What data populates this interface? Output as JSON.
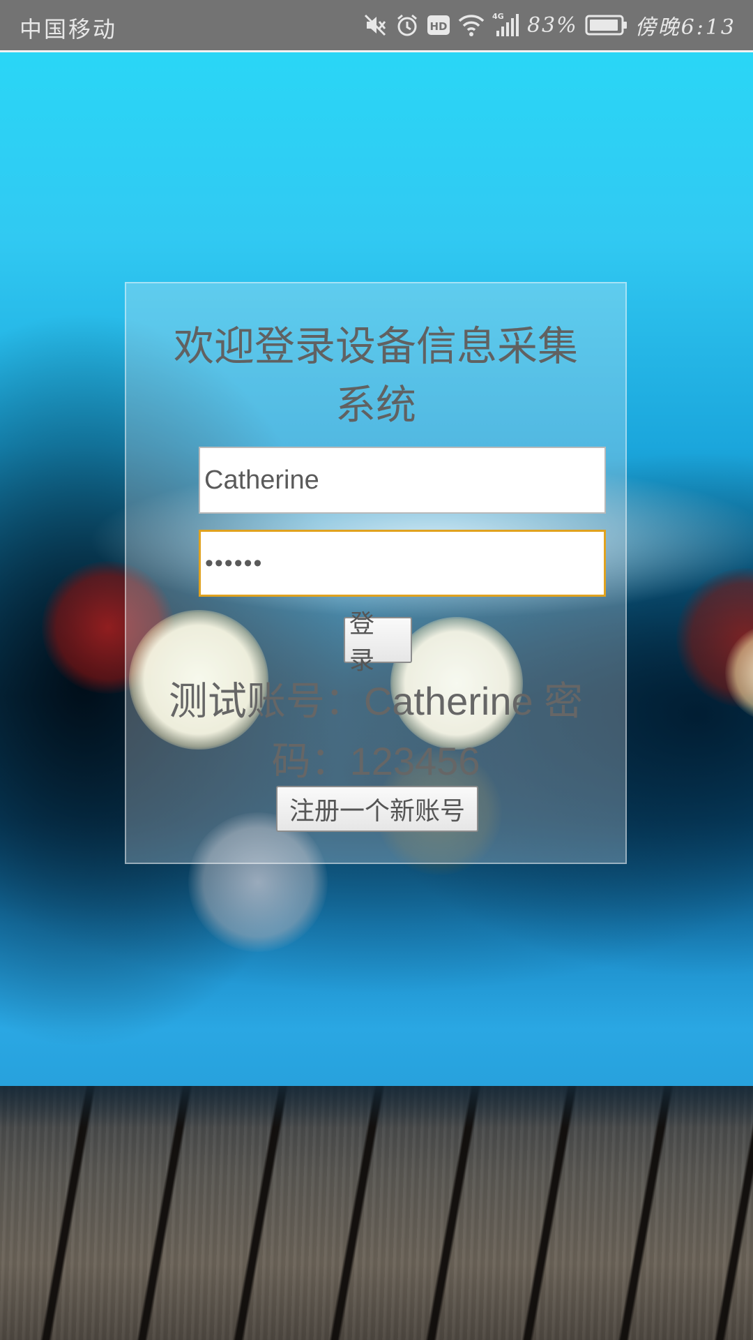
{
  "status_bar": {
    "carrier": "中国移动",
    "network": "4G",
    "battery_percent": "83%",
    "time": "傍晚6:13",
    "icons": [
      "mute-icon",
      "alarm-icon",
      "hd-icon",
      "wifi-icon",
      "cellular-signal-icon",
      "battery-icon"
    ]
  },
  "login": {
    "title_line1": "欢迎登录设备信息采集",
    "title_line2": "系统",
    "username_value": "Catherine",
    "password_value": "••••••",
    "login_button": "登 录",
    "hint_line1": "测试账号：Catherine 密",
    "hint_line2": "码：123456",
    "register_button": "注册一个新账号"
  },
  "colors": {
    "status_bar": "#737373",
    "focus_border": "#e0a21f",
    "text": "#616161"
  }
}
